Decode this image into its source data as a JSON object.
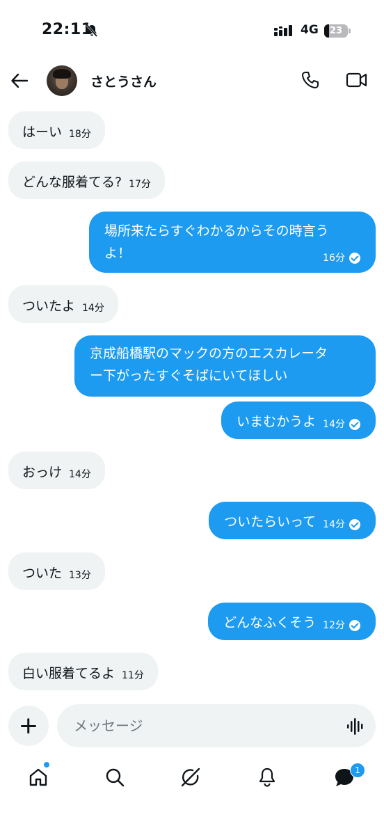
{
  "status_bar": {
    "time": "22:11",
    "network": "4G",
    "battery": "23"
  },
  "header": {
    "contact_name": "さとうさん"
  },
  "messages": [
    {
      "text": "はーい",
      "time": "18分"
    },
    {
      "text": "どんな服着てる?",
      "time": "17分"
    },
    {
      "text": "場所来たらすぐわかるからその時言うよ！",
      "line1": "場所来たらすぐわかるからその時言う",
      "line2": "よ！",
      "time": "16分"
    },
    {
      "text": "ついたよ",
      "time": "14分"
    },
    {
      "line1": "京成船橋駅のマックの方のエスカレータ",
      "line2": "ー下がったすぐそばにいてほしい"
    },
    {
      "text": "いまむかうよ",
      "time": "14分"
    },
    {
      "text": "おっけ",
      "time": "14分"
    },
    {
      "text": "ついたらいって",
      "time": "14分"
    },
    {
      "text": "ついた",
      "time": "13分"
    },
    {
      "text": "どんなふくそう",
      "time": "12分"
    },
    {
      "text": "白い服着てるよ",
      "time": "11分"
    }
  ],
  "composer": {
    "placeholder": "メッセージ"
  },
  "nav": {
    "messages_badge": "1"
  },
  "colors": {
    "accent": "#1d9bf0",
    "incoming_bg": "#eff3f4",
    "text": "#0f1419"
  },
  "icons": [
    "bell-slash-icon",
    "signal-icon",
    "back-arrow-icon",
    "phone-icon",
    "video-icon",
    "plus-icon",
    "voice-icon",
    "home-icon",
    "search-icon",
    "grok-icon",
    "notifications-icon",
    "messages-icon"
  ]
}
